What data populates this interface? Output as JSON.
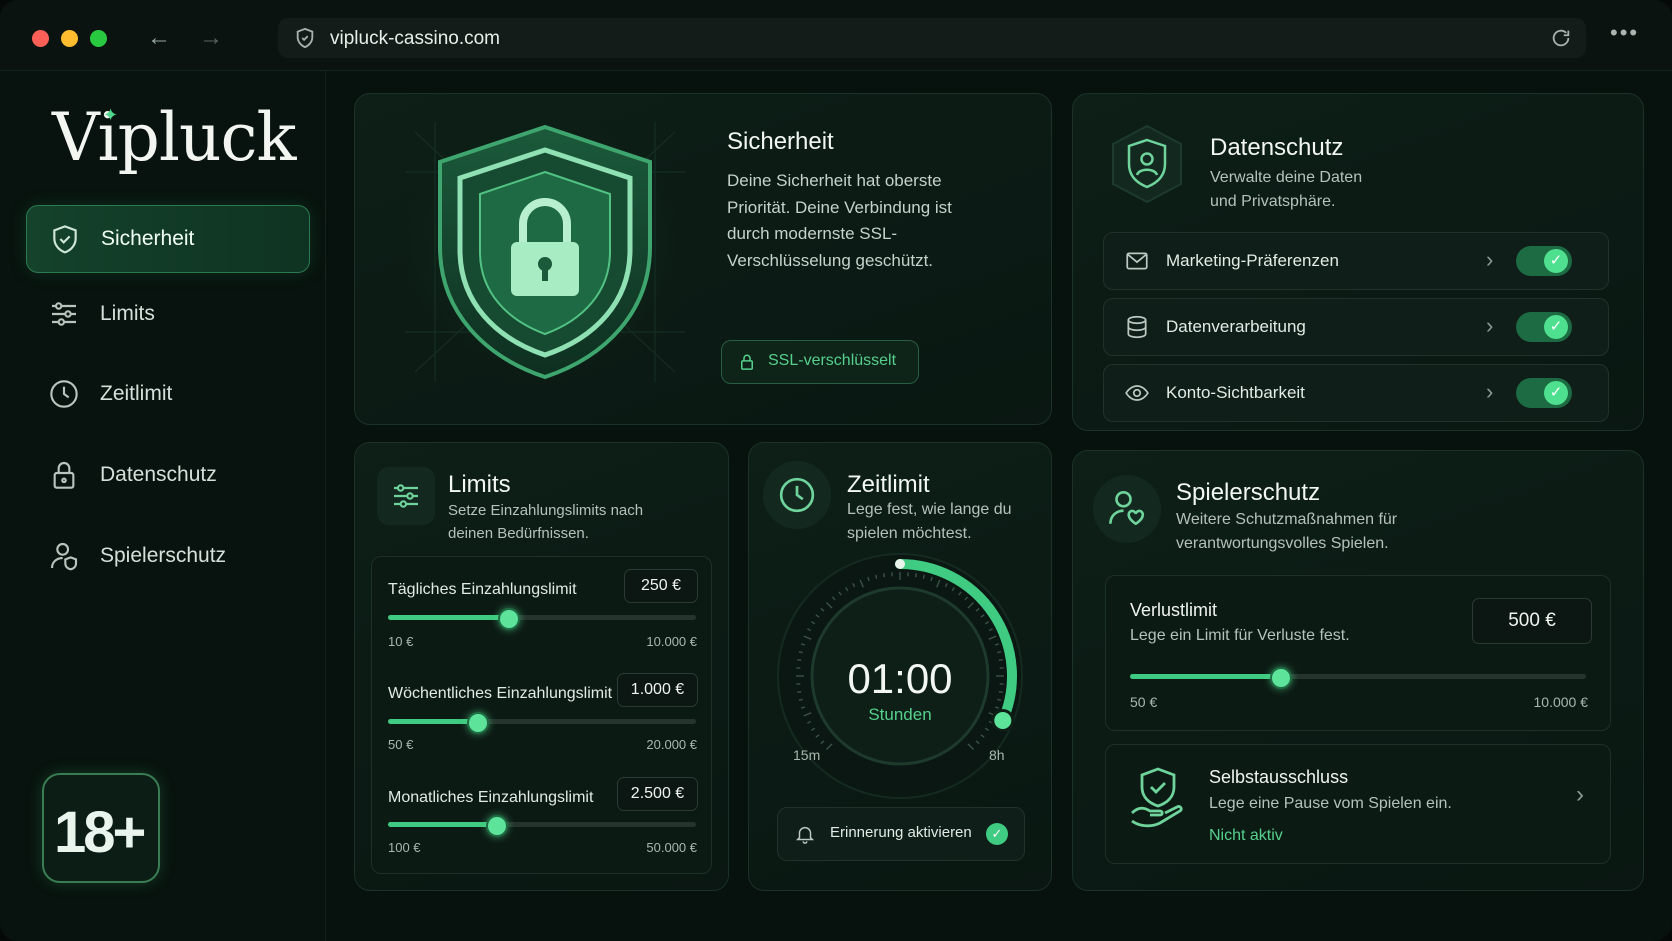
{
  "browser": {
    "url": "vipluck-cassino.com",
    "back_icon": "arrow-left-icon",
    "forward_icon": "arrow-right-icon",
    "reload_icon": "reload-icon",
    "more_label": "•••"
  },
  "sidebar": {
    "logo": "Vipluck",
    "items": [
      {
        "label": "Sicherheit",
        "icon": "shield-check-icon",
        "active": true
      },
      {
        "label": "Limits",
        "icon": "sliders-icon",
        "active": false
      },
      {
        "label": "Zeitlimit",
        "icon": "clock-icon",
        "active": false
      },
      {
        "label": "Datenschutz",
        "icon": "lock-icon",
        "active": false
      },
      {
        "label": "Spielerschutz",
        "icon": "user-shield-icon",
        "active": false
      }
    ],
    "age_badge": "18+"
  },
  "security": {
    "title": "Sicherheit",
    "text": "Deine Sicherheit hat oberste Priorität. Deine Verbindung ist durch modernste SSL-Verschlüsselung geschützt.",
    "badge": "SSL-verschlüsselt"
  },
  "privacy": {
    "title": "Datenschutz",
    "subtitle": "Verwalte deine Daten und Privatsphäre.",
    "rows": [
      {
        "label": "Marketing-Präferenzen",
        "icon": "mail-icon",
        "enabled": true
      },
      {
        "label": "Datenverarbeitung",
        "icon": "database-icon",
        "enabled": true
      },
      {
        "label": "Konto-Sichtbarkeit",
        "icon": "eye-icon",
        "enabled": true
      }
    ]
  },
  "limits": {
    "title": "Limits",
    "subtitle": "Setze Einzahlungslimits nach deinen Bedürfnissen.",
    "items": [
      {
        "label": "Tägliches Einzahlungslimit",
        "value": "250 €",
        "min": "10 €",
        "max": "10.000 €",
        "fraction": 0.39
      },
      {
        "label": "Wöchentliches Einzahlungslimit",
        "value": "1.000 €",
        "min": "50 €",
        "max": "20.000 €",
        "fraction": 0.29
      },
      {
        "label": "Monatliches Einzahlungslimit",
        "value": "2.500 €",
        "min": "100 €",
        "max": "50.000 €",
        "fraction": 0.35
      }
    ]
  },
  "timelimit": {
    "title": "Zeitlimit",
    "subtitle": "Lege fest, wie lange du spielen möchtest.",
    "time": "01:00",
    "unit": "Stunden",
    "min": "15m",
    "max": "8h",
    "fraction": 0.42,
    "reminder": "Erinnerung aktivieren"
  },
  "playerprotection": {
    "title": "Spielerschutz",
    "subtitle": "Weitere Schutzmaßnahmen für verantwortungsvolles Spielen.",
    "loss": {
      "title": "Verlustlimit",
      "text": "Lege ein Limit für Verluste fest.",
      "value": "500 €",
      "min": "50 €",
      "max": "10.000 €",
      "fraction": 0.33
    },
    "selfexclusion": {
      "title": "Selbstausschluss",
      "text": "Lege eine Pause vom Spielen ein.",
      "status": "Nicht aktiv"
    }
  },
  "colors": {
    "accent": "#4fd78d",
    "background": "#07110d",
    "card": "#0d1f17"
  }
}
